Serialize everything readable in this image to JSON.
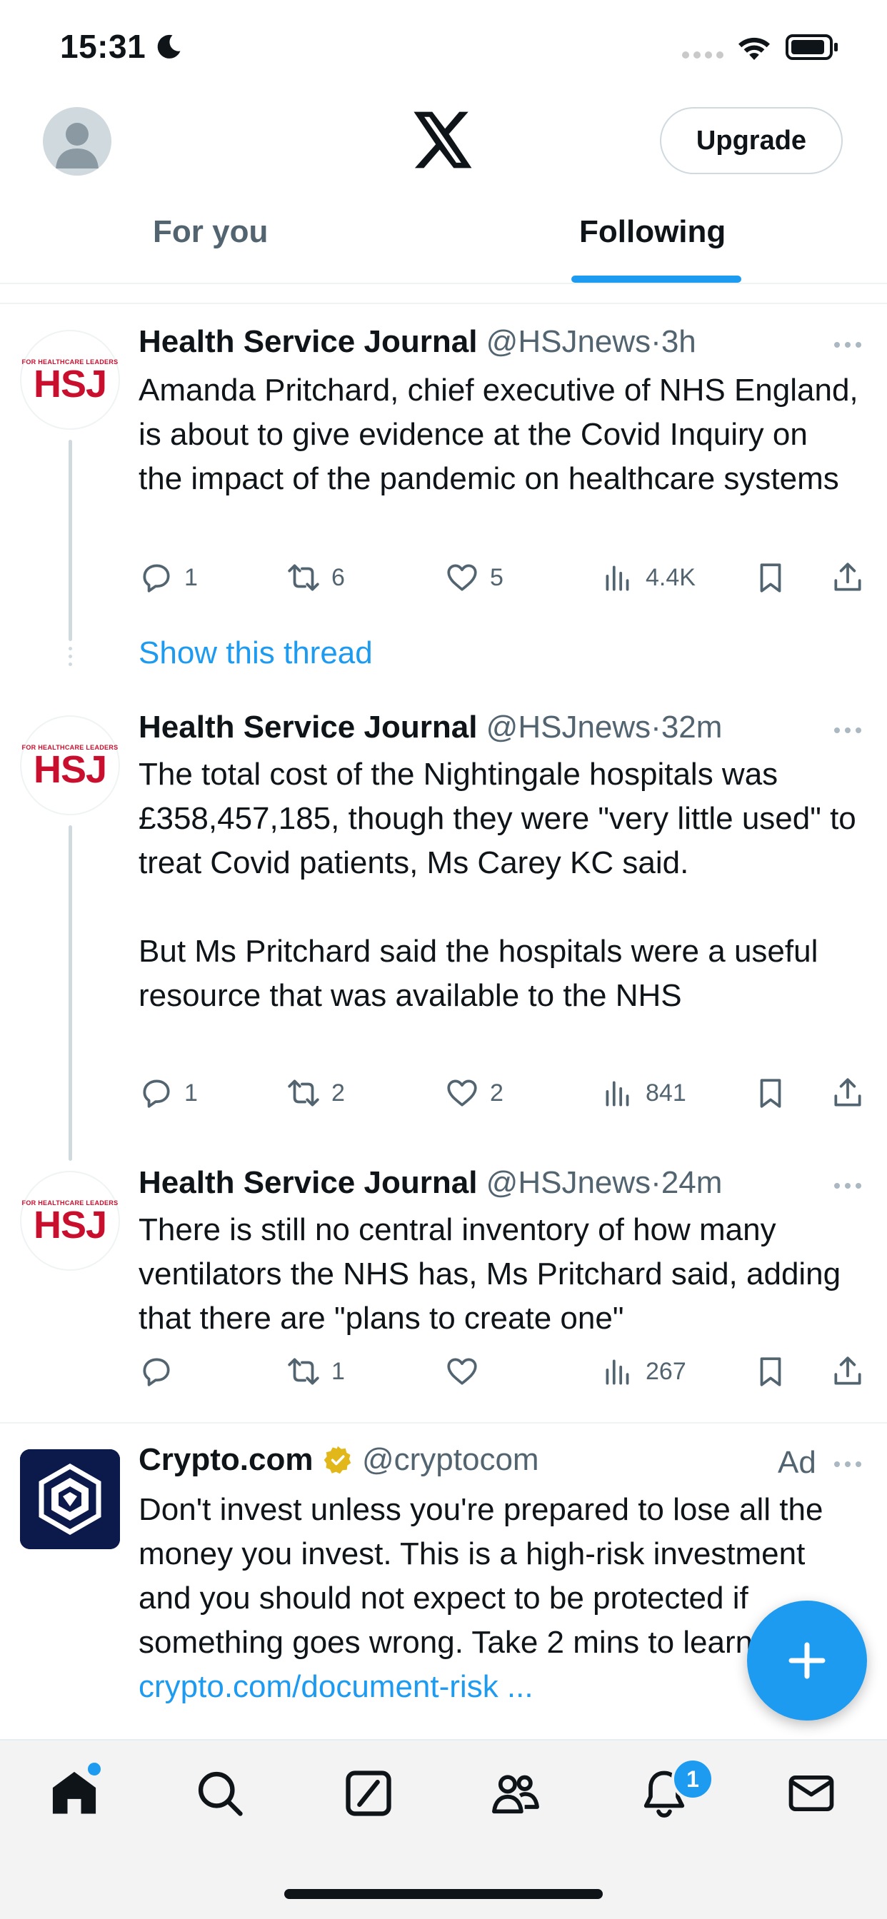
{
  "status_bar": {
    "time": "15:31"
  },
  "header": {
    "upgrade_label": "Upgrade",
    "tabs": [
      {
        "label": "For you",
        "selected": false
      },
      {
        "label": "Following",
        "selected": true
      }
    ]
  },
  "colors": {
    "accent": "#1d9bf0",
    "hsj_red": "#c8102e",
    "text_primary": "#0f1419",
    "text_secondary": "#536471"
  },
  "tweets": [
    {
      "name": "Health Service Journal",
      "handle": "@HSJnews",
      "sep": "·",
      "time": "3h",
      "avatar_small": "FOR HEALTHCARE LEADERS",
      "avatar_big": "HSJ",
      "text": "Amanda Pritchard, chief executive of NHS England, is about to give evidence at the Covid Inquiry on the impact of the pandemic on healthcare systems",
      "replies": "1",
      "reposts": "6",
      "likes": "5",
      "views": "4.4K"
    },
    {
      "name": "Health Service Journal",
      "handle": "@HSJnews",
      "sep": "·",
      "time": "32m",
      "avatar_small": "FOR HEALTHCARE LEADERS",
      "avatar_big": "HSJ",
      "text_p1": "The total cost of the Nightingale hospitals was £358,457,185, though they were \"very little used\" to treat Covid patients, Ms Carey KC said.",
      "text_p2": "But Ms Pritchard said the hospitals were a useful resource that was available to the NHS",
      "replies": "1",
      "reposts": "2",
      "likes": "2",
      "views": "841"
    },
    {
      "name": "Health Service Journal",
      "handle": "@HSJnews",
      "sep": "·",
      "time": "24m",
      "avatar_small": "FOR HEALTHCARE LEADERS",
      "avatar_big": "HSJ",
      "text": "There is still no central inventory of how many ventilators the NHS has, Ms Pritchard said, adding that there are \"plans to create one\"",
      "replies": "",
      "reposts": "1",
      "likes": "",
      "views": "267"
    }
  ],
  "show_thread_label": "Show this thread",
  "ad": {
    "name": "Crypto.com",
    "handle": "@cryptocom",
    "label": "Ad",
    "text": "Don't invest unless you're prepared to lose all the money you invest. This is a high-risk investment and you should not expect to be protected if something goes wrong. Take 2 mins to learn more: ",
    "link": "crypto.com/document-risk ..."
  },
  "bottom_nav": {
    "items": [
      "home-icon",
      "search-icon",
      "grok-icon",
      "communities-icon",
      "notifications-icon",
      "messages-icon"
    ],
    "notifications_badge": "1"
  }
}
